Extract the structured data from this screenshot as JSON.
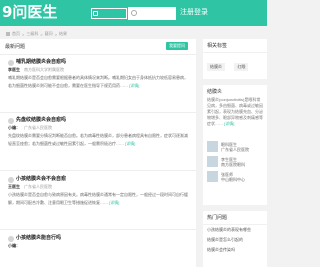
{
  "header": {
    "logo": "9问医生",
    "user_label": "注册登录"
  },
  "breadcrumb": {
    "items": [
      "首页",
      ">",
      "三级科",
      ">",
      "疑问",
      ">",
      "结果"
    ]
  },
  "main": {
    "title": "最新问题",
    "ask_label": "我要提问",
    "questions": [
      {
        "title": "哺乳期结膜炎会自愈吗",
        "author": "李医生",
        "dept": "南方医科大学附属医院",
        "body": "哺乳期结膜炎是否会自愈需要根据患者的具体情况来判断。哺乳期妇女由于身体抵抗力较低容易患病，若为细菌性结膜炎则可能不会自愈，需要在医生指导下规范用药……",
        "more": "[详情]"
      },
      {
        "title": "先盘纹结膜炎会自愈吗",
        "author": "小编：",
        "dept": "广东省人民医院",
        "body": "先盘纹结膜炎需要分情况判断能否自愈。若为病毒性结膜炎，部分患者病程具有自限性，症状可逐渐减轻直至痊愈；若为细菌性或过敏性因素引起，一般需积极治疗……",
        "more": "[详情]"
      },
      {
        "title": "小孩结膜炎会不会自愈",
        "author": "王医生",
        "dept": "广东省人民医院",
        "body": "小孩结膜炎是否会自愈与致病原因有关。病毒性结膜炎通常有一定自限性，一般经过一段时间可自行缓解，期间可配合冷敷、注意用眼卫生等措施促进恢复……",
        "more": "[详情]"
      },
      {
        "title": "小孩结膜炎能自行吗",
        "author": "小编：",
        "dept": ""
      }
    ]
  },
  "sidebar": {
    "tags_title": "相关标签",
    "tags": [
      "结膜炎",
      "红眼"
    ],
    "topic_title": "结膜炎",
    "topic_label": "结膜炎",
    "topic_body": "结膜炎(conjunctivitis)是眼科常见病，多由细菌、病毒或过敏因素引起，表现为结膜充血、分泌物增多、眼部异物感及刺痛感等症状……",
    "topic_more": "[详情]",
    "doctors": [
      {
        "name": "眼科医生",
        "desc": "广东省人民医院"
      },
      {
        "name": "李生医生",
        "desc": "南方医院眼科"
      },
      {
        "name": "张医师",
        "desc": "中山眼科中心"
      }
    ],
    "hot_title": "热门问题",
    "hot_items": [
      "小孩结膜炎的表现有哪些",
      "结膜炎是怎么引起的",
      "结膜炎会传染吗"
    ]
  }
}
